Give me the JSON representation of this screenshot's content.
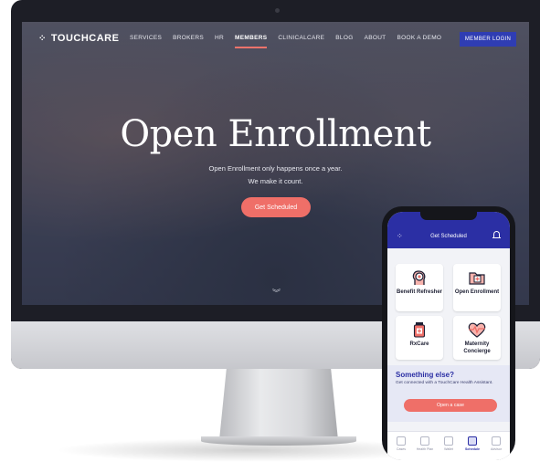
{
  "website": {
    "logo_text": "TOUCHCARE",
    "nav_items": [
      "SERVICES",
      "BROKERS",
      "HR",
      "MEMBERS",
      "CLINICALCARE",
      "BLOG",
      "ABOUT",
      "BOOK A DEMO"
    ],
    "active_nav": "MEMBERS",
    "login_label": "MEMBER LOGIN",
    "hero_title": "Open Enrollment",
    "hero_line1": "Open Enrollment only happens once a year.",
    "hero_line2": "We make it count.",
    "cta_label": "Get Scheduled"
  },
  "phone": {
    "header_title": "Get Scheduled",
    "cards": {
      "benefit": "Benefit Refresher",
      "open": "Open Enrollment",
      "rx": "RxCare",
      "maternity": "Maternity Concierge"
    },
    "else_title": "Something else?",
    "else_text": "Get connected with a TouchCare Health Assistant.",
    "else_button": "Open a case",
    "tabs": [
      "Cases",
      "Health Plan",
      "Wallet",
      "Schedule",
      "Advisor"
    ],
    "active_tab": "Schedule"
  },
  "colors": {
    "brand_blue": "#2b2fa4",
    "coral": "#ef6f68",
    "login_blue": "#2f3db3"
  }
}
